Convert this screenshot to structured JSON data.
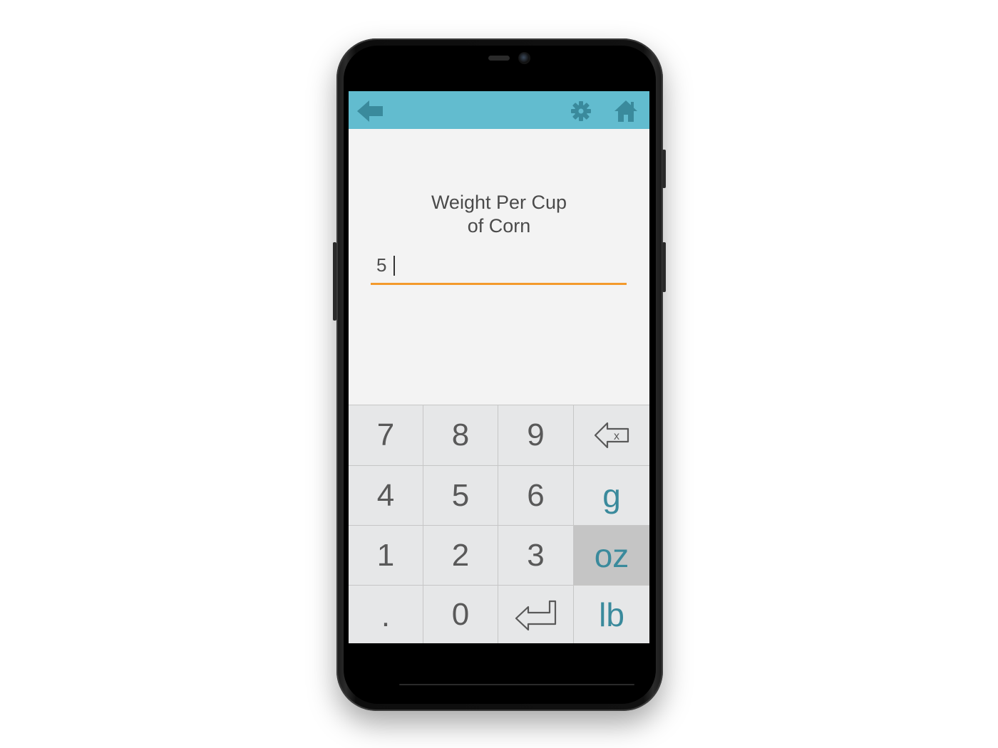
{
  "header": {
    "back_icon": "back-arrow-icon",
    "settings_icon": "gear-icon",
    "home_icon": "home-icon",
    "bar_color": "#62bccf",
    "icon_color": "#3a8a9c"
  },
  "title": {
    "line1": "Weight Per Cup",
    "line2": "of Corn"
  },
  "input": {
    "value": "5",
    "underline_color": "#f39a2c"
  },
  "keypad": {
    "k7": "7",
    "k8": "8",
    "k9": "9",
    "backspace_icon": "backspace-icon",
    "k4": "4",
    "k5": "5",
    "k6": "6",
    "unit_g": "g",
    "k1": "1",
    "k2": "2",
    "k3": "3",
    "unit_oz": "oz",
    "kdot": ".",
    "k0": "0",
    "enter_icon": "enter-icon",
    "unit_lb": "lb",
    "selected_unit": "oz"
  }
}
